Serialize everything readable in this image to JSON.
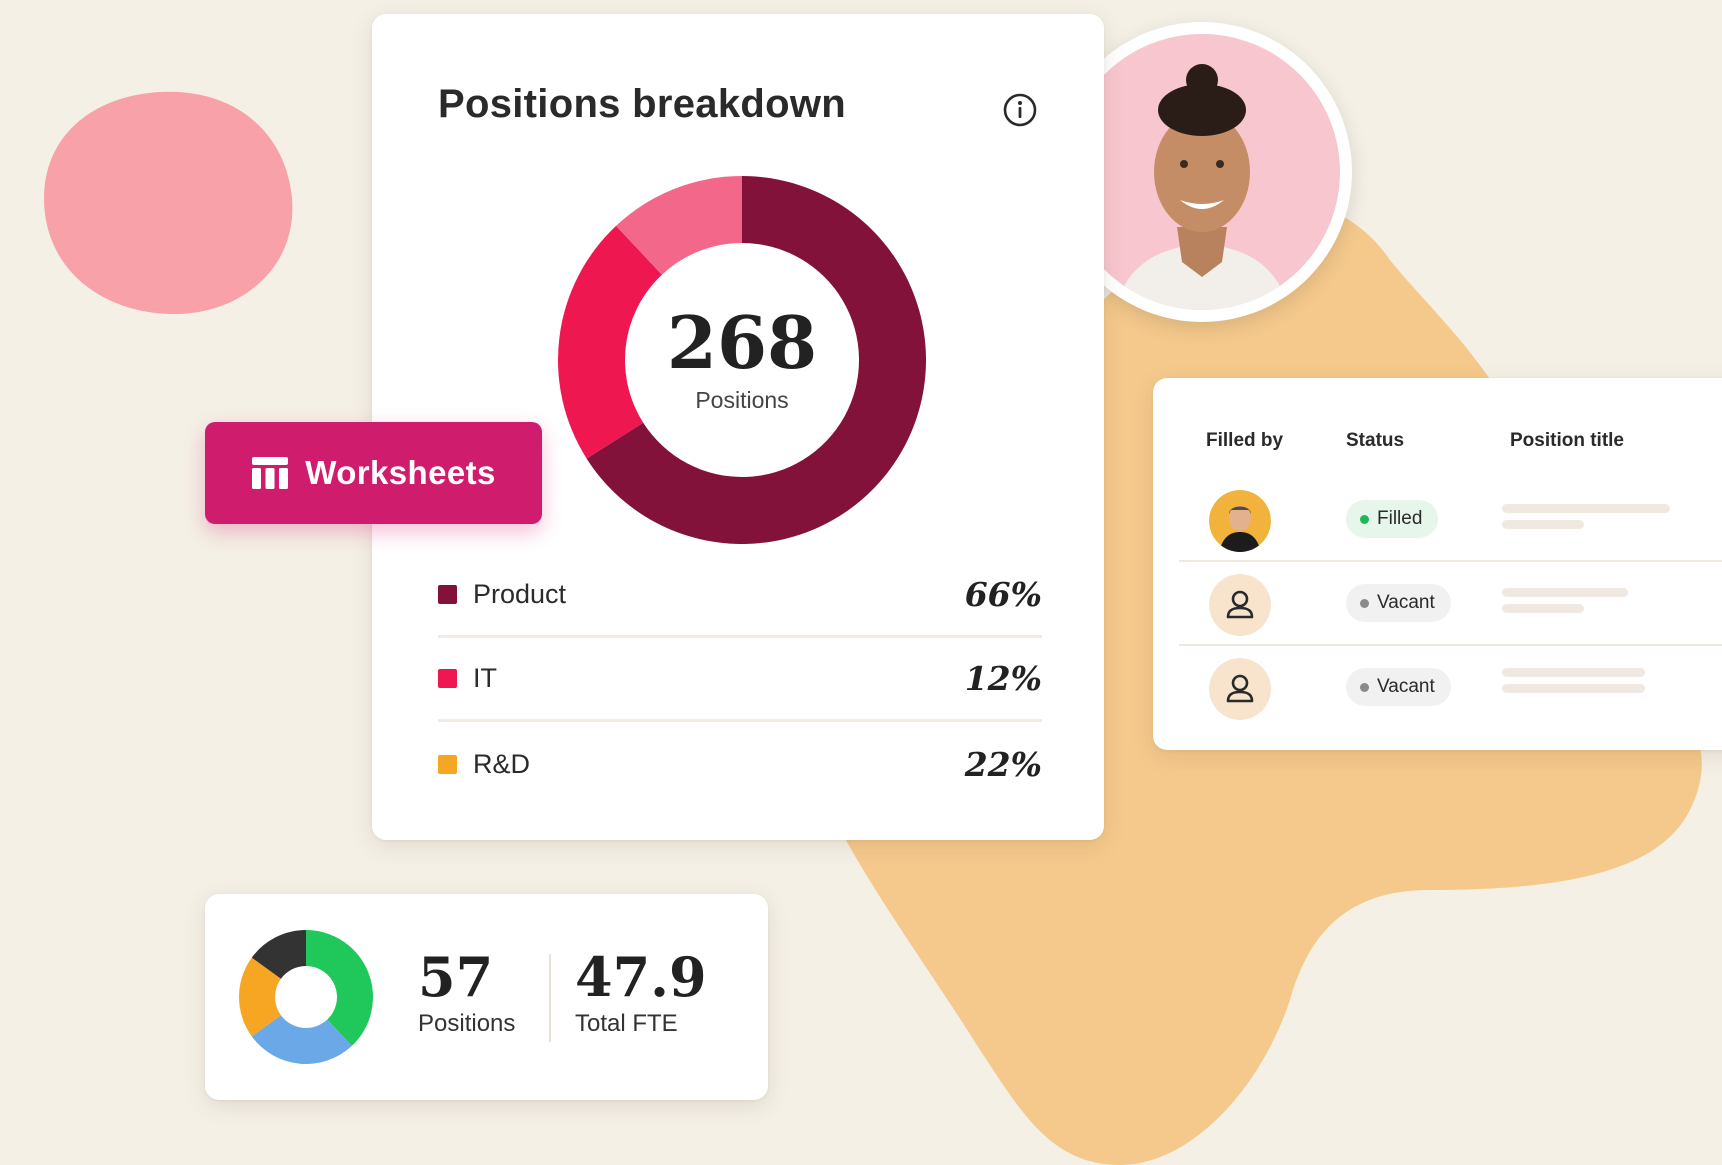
{
  "breakdown": {
    "title": "Positions breakdown",
    "total": "268",
    "total_caption": "Positions",
    "segments": [
      {
        "label": "Product",
        "percent": "66%",
        "value": 66,
        "color": "#82123a"
      },
      {
        "label": "IT",
        "percent": "12%",
        "value": 12,
        "color": "#ee1750"
      },
      {
        "label": "R&D",
        "percent": "22%",
        "value": 22,
        "color": "#f6a623"
      }
    ],
    "donut_colors": [
      "#82123a",
      "#ee1750",
      "#f2678a"
    ]
  },
  "worksheets_button": {
    "label": "Worksheets",
    "icon": "table-icon",
    "color": "#d01c6d"
  },
  "table": {
    "headers": [
      "Filled by",
      "Status",
      "Position title"
    ],
    "rows": [
      {
        "avatar": "person-photo",
        "status": "Filled",
        "status_color": "#1db954",
        "pill_bg": "#e6f6ea"
      },
      {
        "avatar": "user-icon",
        "status": "Vacant",
        "status_color": "#8a8a8a",
        "pill_bg": "#f1f1f1"
      },
      {
        "avatar": "user-icon",
        "status": "Vacant",
        "status_color": "#8a8a8a",
        "pill_bg": "#f1f1f1"
      }
    ]
  },
  "summary": {
    "positions_value": "57",
    "positions_label": "Positions",
    "fte_value": "47.9",
    "fte_label": "Total FTE",
    "mini_donut_colors": [
      "#20c75a",
      "#6aa8e8",
      "#f6a623",
      "#333333"
    ]
  },
  "colors": {
    "background": "#f4f0e6",
    "blob_pink": "#f8a1a8",
    "blob_orange": "#f5c98c"
  }
}
